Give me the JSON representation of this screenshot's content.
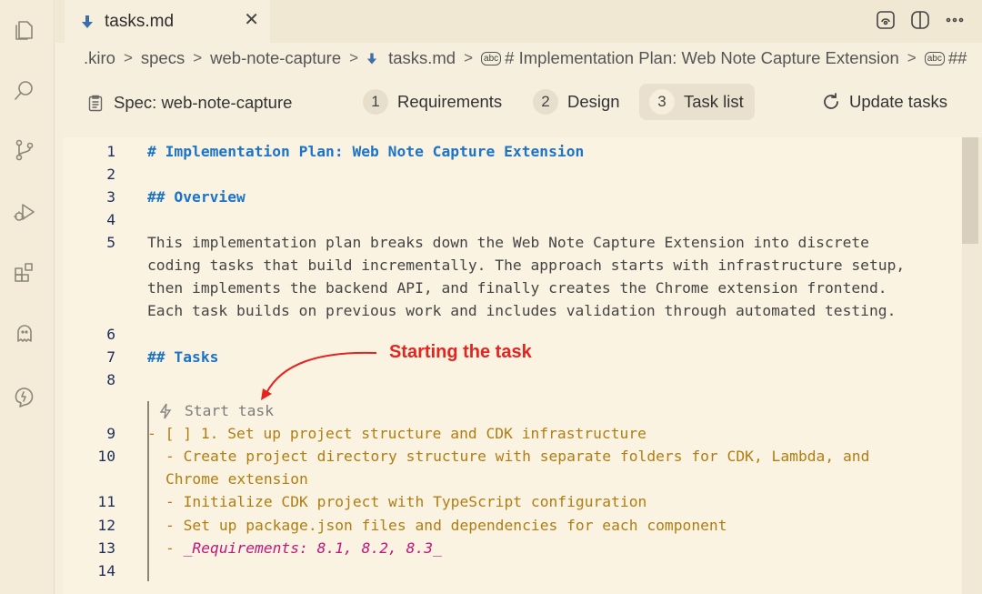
{
  "tab": {
    "title": "tasks.md",
    "close": "✕"
  },
  "breadcrumb": {
    "items": [
      ".kiro",
      "specs",
      "web-note-capture",
      "tasks.md",
      "# Implementation Plan: Web Note Capture Extension",
      "##"
    ],
    "separator": ">",
    "abc_badge": "abc"
  },
  "spec_bar": {
    "label": "Spec: web-note-capture",
    "steps": [
      {
        "num": "1",
        "label": "Requirements"
      },
      {
        "num": "2",
        "label": "Design"
      },
      {
        "num": "3",
        "label": "Task list"
      }
    ],
    "active_step": "Task list",
    "update_label": "Update tasks"
  },
  "editor": {
    "line_numbers": [
      "1",
      "2",
      "3",
      "4",
      "5",
      "6",
      "7",
      "8",
      "9",
      "10",
      "11",
      "12",
      "13",
      "14"
    ],
    "lines": {
      "l1": "# Implementation Plan: Web Note Capture Extension",
      "l3": "## Overview",
      "l5a": "This implementation plan breaks down the Web Note Capture Extension into discrete",
      "l5b": "coding tasks that build incrementally. The approach starts with infrastructure setup,",
      "l5c": "then implements the backend API, and finally creates the Chrome extension frontend.",
      "l5d": "Each task builds on previous work and includes validation through automated testing.",
      "l7": "## Tasks",
      "codelens": "Start task",
      "l9": "- [ ] 1. Set up project structure and CDK infrastructure",
      "l10a": "- Create project directory structure with separate folders for CDK, Lambda, and",
      "l10b": "Chrome extension",
      "l11": "- Initialize CDK project with TypeScript configuration",
      "l12": "- Set up package.json files and dependencies for each component",
      "l13_prefix": "- ",
      "l13_req": "_Requirements: 8.1, 8.2, 8.3_"
    }
  },
  "annotation": {
    "text": "Starting the task",
    "color": "#e5231f"
  },
  "colors": {
    "heading": "#1c74c8",
    "task": "#b07d12",
    "requirements": "#c2167d",
    "background": "#faf3e1"
  },
  "icons": [
    "explorer-icon",
    "search-icon",
    "source-control-icon",
    "run-debug-icon",
    "extensions-icon",
    "kiro-ghost-icon",
    "kiro-agent-icon",
    "open-preview-icon",
    "split-editor-icon",
    "more-actions-icon"
  ]
}
